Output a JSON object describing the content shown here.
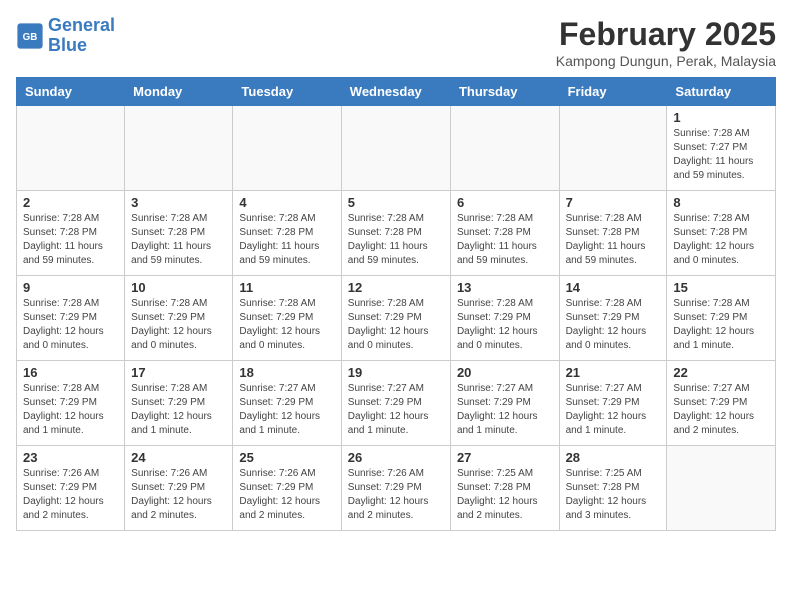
{
  "header": {
    "logo_line1": "General",
    "logo_line2": "Blue",
    "month_title": "February 2025",
    "location": "Kampong Dungun, Perak, Malaysia"
  },
  "weekdays": [
    "Sunday",
    "Monday",
    "Tuesday",
    "Wednesday",
    "Thursday",
    "Friday",
    "Saturday"
  ],
  "weeks": [
    [
      {
        "day": "",
        "info": ""
      },
      {
        "day": "",
        "info": ""
      },
      {
        "day": "",
        "info": ""
      },
      {
        "day": "",
        "info": ""
      },
      {
        "day": "",
        "info": ""
      },
      {
        "day": "",
        "info": ""
      },
      {
        "day": "1",
        "info": "Sunrise: 7:28 AM\nSunset: 7:27 PM\nDaylight: 11 hours and 59 minutes."
      }
    ],
    [
      {
        "day": "2",
        "info": "Sunrise: 7:28 AM\nSunset: 7:28 PM\nDaylight: 11 hours and 59 minutes."
      },
      {
        "day": "3",
        "info": "Sunrise: 7:28 AM\nSunset: 7:28 PM\nDaylight: 11 hours and 59 minutes."
      },
      {
        "day": "4",
        "info": "Sunrise: 7:28 AM\nSunset: 7:28 PM\nDaylight: 11 hours and 59 minutes."
      },
      {
        "day": "5",
        "info": "Sunrise: 7:28 AM\nSunset: 7:28 PM\nDaylight: 11 hours and 59 minutes."
      },
      {
        "day": "6",
        "info": "Sunrise: 7:28 AM\nSunset: 7:28 PM\nDaylight: 11 hours and 59 minutes."
      },
      {
        "day": "7",
        "info": "Sunrise: 7:28 AM\nSunset: 7:28 PM\nDaylight: 11 hours and 59 minutes."
      },
      {
        "day": "8",
        "info": "Sunrise: 7:28 AM\nSunset: 7:28 PM\nDaylight: 12 hours and 0 minutes."
      }
    ],
    [
      {
        "day": "9",
        "info": "Sunrise: 7:28 AM\nSunset: 7:29 PM\nDaylight: 12 hours and 0 minutes."
      },
      {
        "day": "10",
        "info": "Sunrise: 7:28 AM\nSunset: 7:29 PM\nDaylight: 12 hours and 0 minutes."
      },
      {
        "day": "11",
        "info": "Sunrise: 7:28 AM\nSunset: 7:29 PM\nDaylight: 12 hours and 0 minutes."
      },
      {
        "day": "12",
        "info": "Sunrise: 7:28 AM\nSunset: 7:29 PM\nDaylight: 12 hours and 0 minutes."
      },
      {
        "day": "13",
        "info": "Sunrise: 7:28 AM\nSunset: 7:29 PM\nDaylight: 12 hours and 0 minutes."
      },
      {
        "day": "14",
        "info": "Sunrise: 7:28 AM\nSunset: 7:29 PM\nDaylight: 12 hours and 0 minutes."
      },
      {
        "day": "15",
        "info": "Sunrise: 7:28 AM\nSunset: 7:29 PM\nDaylight: 12 hours and 1 minute."
      }
    ],
    [
      {
        "day": "16",
        "info": "Sunrise: 7:28 AM\nSunset: 7:29 PM\nDaylight: 12 hours and 1 minute."
      },
      {
        "day": "17",
        "info": "Sunrise: 7:28 AM\nSunset: 7:29 PM\nDaylight: 12 hours and 1 minute."
      },
      {
        "day": "18",
        "info": "Sunrise: 7:27 AM\nSunset: 7:29 PM\nDaylight: 12 hours and 1 minute."
      },
      {
        "day": "19",
        "info": "Sunrise: 7:27 AM\nSunset: 7:29 PM\nDaylight: 12 hours and 1 minute."
      },
      {
        "day": "20",
        "info": "Sunrise: 7:27 AM\nSunset: 7:29 PM\nDaylight: 12 hours and 1 minute."
      },
      {
        "day": "21",
        "info": "Sunrise: 7:27 AM\nSunset: 7:29 PM\nDaylight: 12 hours and 1 minute."
      },
      {
        "day": "22",
        "info": "Sunrise: 7:27 AM\nSunset: 7:29 PM\nDaylight: 12 hours and 2 minutes."
      }
    ],
    [
      {
        "day": "23",
        "info": "Sunrise: 7:26 AM\nSunset: 7:29 PM\nDaylight: 12 hours and 2 minutes."
      },
      {
        "day": "24",
        "info": "Sunrise: 7:26 AM\nSunset: 7:29 PM\nDaylight: 12 hours and 2 minutes."
      },
      {
        "day": "25",
        "info": "Sunrise: 7:26 AM\nSunset: 7:29 PM\nDaylight: 12 hours and 2 minutes."
      },
      {
        "day": "26",
        "info": "Sunrise: 7:26 AM\nSunset: 7:29 PM\nDaylight: 12 hours and 2 minutes."
      },
      {
        "day": "27",
        "info": "Sunrise: 7:25 AM\nSunset: 7:28 PM\nDaylight: 12 hours and 2 minutes."
      },
      {
        "day": "28",
        "info": "Sunrise: 7:25 AM\nSunset: 7:28 PM\nDaylight: 12 hours and 3 minutes."
      },
      {
        "day": "",
        "info": ""
      }
    ]
  ]
}
